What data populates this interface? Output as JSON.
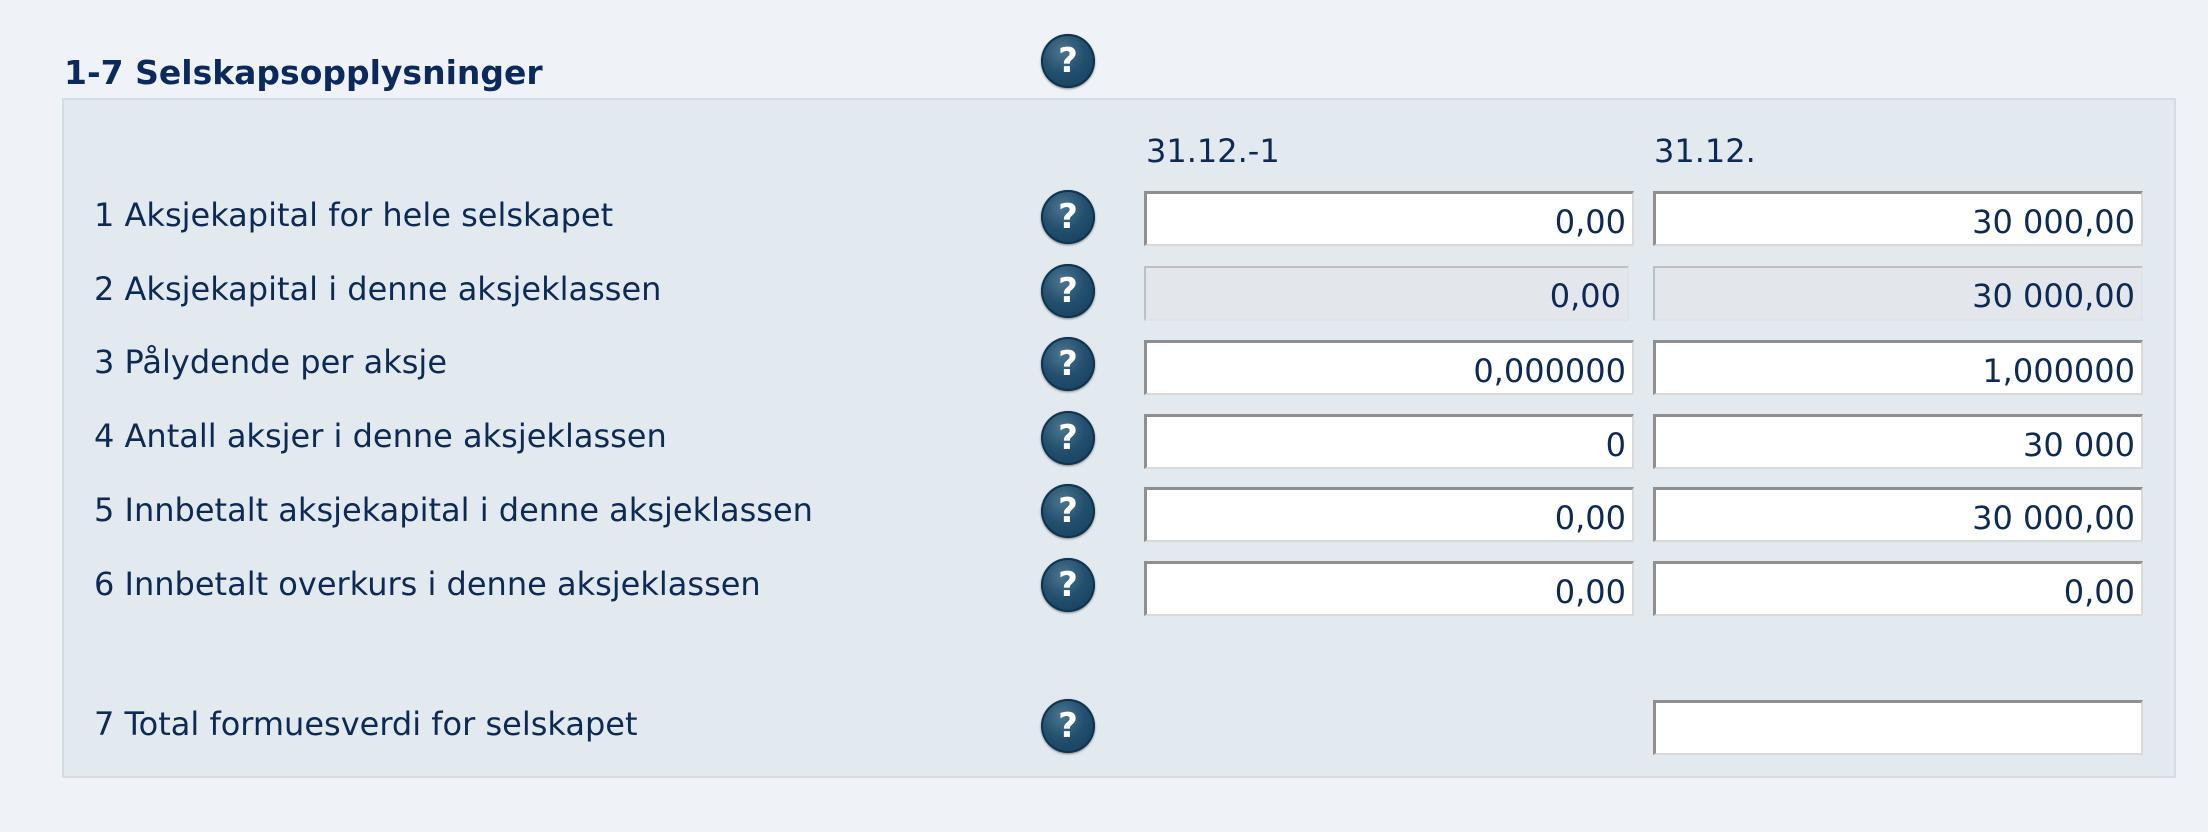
{
  "section": {
    "title": "1-7 Selskapsopplysninger",
    "help_icon": "question-circle-icon"
  },
  "columns": {
    "previous_label": "31.12.-1",
    "current_label": "31.12."
  },
  "rows": [
    {
      "label": "1 Aksjekapital for hele selskapet",
      "previous": "0,00",
      "current": "30 000,00",
      "readonly": false
    },
    {
      "label": "2 Aksjekapital i denne aksjeklassen",
      "previous": "0,00",
      "current": "30 000,00",
      "readonly": true
    },
    {
      "label": "3 Pålydende per aksje",
      "previous": "0,000000",
      "current": "1,000000",
      "readonly": false
    },
    {
      "label": "4 Antall aksjer i denne aksjeklassen",
      "previous": "0",
      "current": "30 000",
      "readonly": false
    },
    {
      "label": "5 Innbetalt aksjekapital i denne aksjeklassen",
      "previous": "0,00",
      "current": "30 000,00",
      "readonly": false
    },
    {
      "label": "6 Innbetalt overkurs i denne aksjeklassen",
      "previous": "0,00",
      "current": "0,00",
      "readonly": false
    }
  ],
  "total": {
    "label": "7 Total formuesverdi for selskapet",
    "current": ""
  },
  "colors": {
    "page_background": "#eff3f7",
    "panel_background": "#e2e9ef",
    "text": "#0d2a55",
    "help_icon": "#1e4a68"
  }
}
